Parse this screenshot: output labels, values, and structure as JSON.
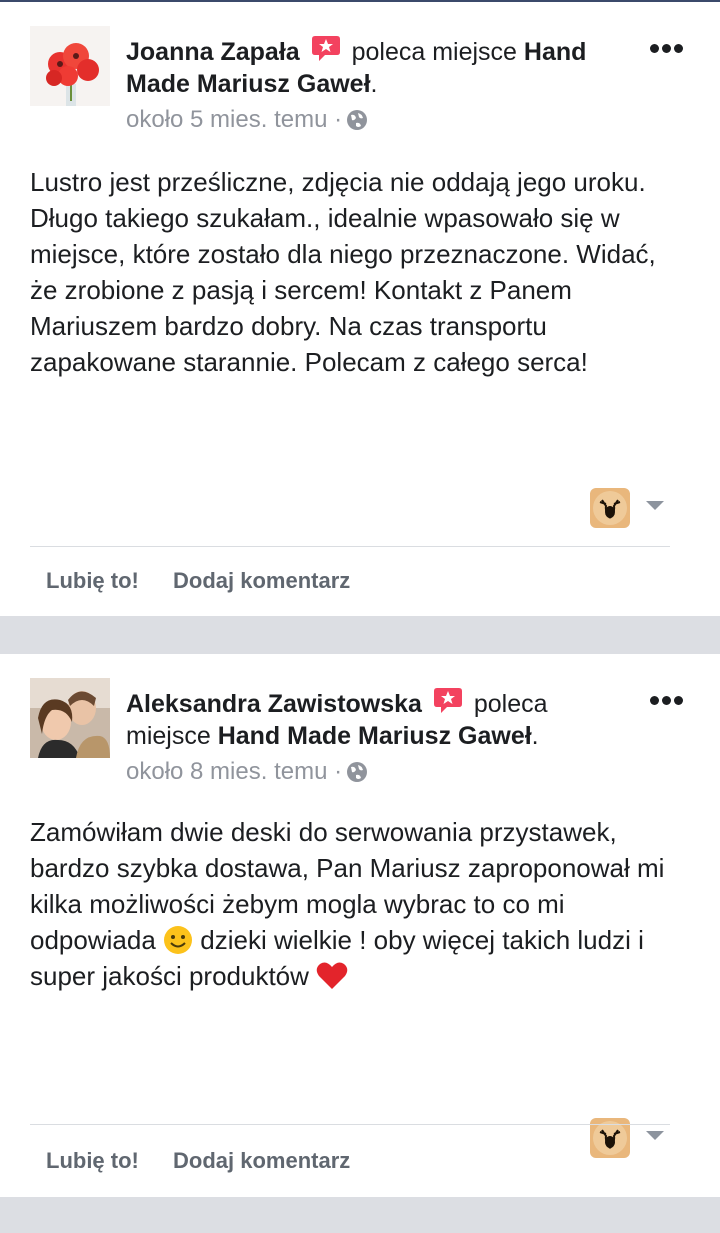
{
  "posts": [
    {
      "author": "Joanna Zapała",
      "recommend_text": "poleca miejsce",
      "page_name": "Hand Made Mariusz Gaweł",
      "period": ".",
      "time": "około 5 mies. temu ·",
      "body": "Lustro jest prześliczne, zdjęcia nie oddają jego uroku. Długo takiego szukałam., idealnie wpasowało się w miejsce, które zostało dla niego przeznaczone. Widać, że zrobione z pasją i sercem! Kontakt z Panem Mariuszem bardzo dobry. Na czas transportu zapakowane starannie. Polecam z całego serca!",
      "like_label": "Lubię to!",
      "comment_label": "Dodaj komentarz"
    },
    {
      "author": "Aleksandra Zawistowska",
      "recommend_text": "poleca miejsce",
      "page_name": "Hand Made Mariusz Gaweł",
      "period": ".",
      "time": "około 8 mies. temu ·",
      "body_part1": "Zamówiłam dwie deski do serwowania przystawek, bardzo szybka dostawa, Pan Mariusz zaproponował mi kilka możliwości żebym mogla wybrac to co mi odpowiada",
      "body_part2": "dzieki wielkie ! oby więcej takich ludzi i super jakości produktów",
      "like_label": "Lubię to!",
      "comment_label": "Dodaj komentarz"
    }
  ],
  "icons": {
    "recommend": "recommend-badge-icon",
    "globe": "globe-icon",
    "more": "more-options-icon",
    "caret": "dropdown-caret-icon",
    "page_thumb": "page-logo-deer",
    "smile": "smiling-face-emoji",
    "heart": "red-heart-emoji"
  },
  "colors": {
    "badge": "#f3425f",
    "meta_gray": "#90949c",
    "action_gray": "#606770",
    "background": "#dcdee3"
  }
}
